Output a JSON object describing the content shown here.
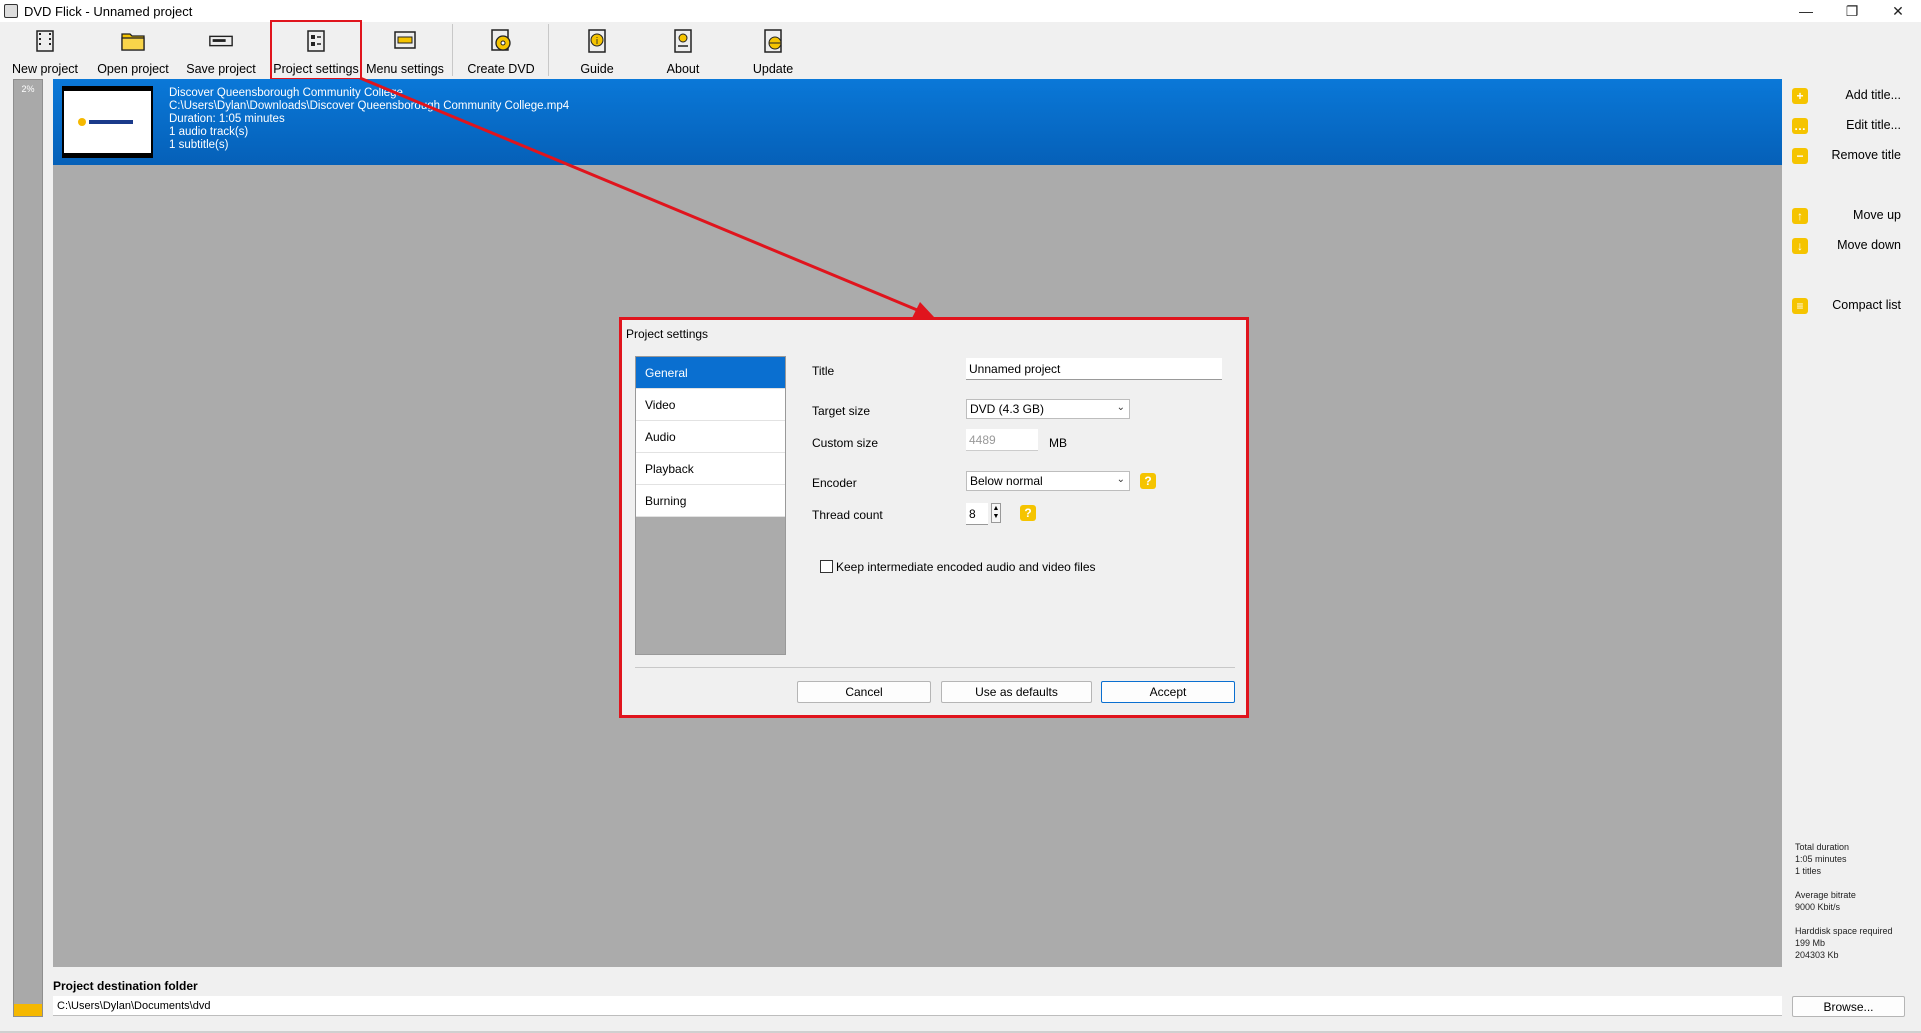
{
  "window": {
    "title": "DVD Flick - Unnamed project",
    "minimize": "—",
    "maximize": "❐",
    "close": "✕"
  },
  "toolbar": {
    "new_project": "New project",
    "open_project": "Open project",
    "save_project": "Save project",
    "project_settings": "Project settings",
    "menu_settings": "Menu settings",
    "create_dvd": "Create DVD",
    "guide": "Guide",
    "about": "About",
    "update": "Update"
  },
  "progress": {
    "label": "2%",
    "value": 0.02
  },
  "title_item": {
    "name": "Discover Queensborough Community College",
    "path": "C:\\Users\\Dylan\\Downloads\\Discover Queensborough Community College.mp4",
    "duration": "Duration: 1:05 minutes",
    "audio_tracks": "1 audio track(s)",
    "subtitles": "1 subtitle(s)"
  },
  "dialog": {
    "title": "Project settings",
    "nav": [
      "General",
      "Video",
      "Audio",
      "Playback",
      "Burning"
    ],
    "active_nav": "General",
    "fields": {
      "title_label": "Title",
      "title_value": "Unnamed project",
      "target_size_label": "Target size",
      "target_size_value": "DVD (4.3 GB)",
      "custom_size_label": "Custom size",
      "custom_size_value": "4489",
      "custom_size_unit": "MB",
      "encoder_label": "Encoder",
      "encoder_value": "Below normal",
      "thread_count_label": "Thread count",
      "thread_count_value": "8",
      "help_glyph": "?",
      "keep_files_label": "Keep intermediate encoded audio and video files",
      "keep_files_checked": false
    },
    "buttons": {
      "cancel": "Cancel",
      "defaults": "Use as defaults",
      "accept": "Accept"
    }
  },
  "side_panel": {
    "add_title": "Add title...",
    "edit_title": "Edit title...",
    "remove_title": "Remove title",
    "move_up": "Move up",
    "move_down": "Move down",
    "compact_list": "Compact list",
    "icons": {
      "add": "+",
      "edit": "…",
      "remove": "−",
      "up": "↑",
      "down": "↓",
      "compact": "≡"
    }
  },
  "stats": {
    "total_duration_label": "Total duration",
    "total_duration_value": "1:05 minutes",
    "titles_count": "1 titles",
    "average_bitrate_label": "Average bitrate",
    "average_bitrate_value": "9000 Kbit/s",
    "harddisk_label": "Harddisk space required",
    "harddisk_mb": "199 Mb",
    "harddisk_kb": "204303 Kb"
  },
  "destination": {
    "label": "Project destination folder",
    "path": "C:\\Users\\Dylan\\Documents\\dvd",
    "browse": "Browse..."
  },
  "colors": {
    "highlight": "#e0141d",
    "selection_blue": "#0a6fd0",
    "accent_yellow": "#f5c400"
  }
}
